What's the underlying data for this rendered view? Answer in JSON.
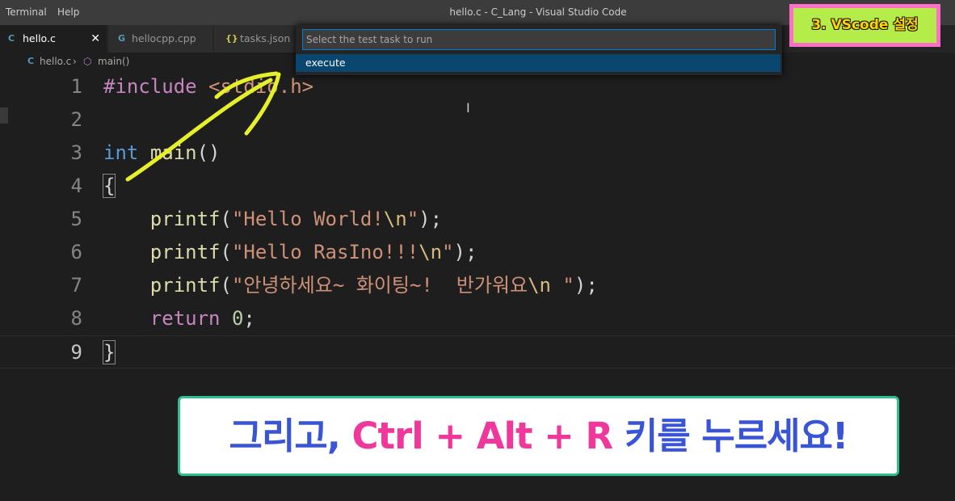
{
  "menu": {
    "terminal": "Terminal",
    "help": "Help"
  },
  "window_title": "hello.c - C_Lang - Visual Studio Code",
  "tabs": [
    {
      "icon": "C",
      "label": "hello.c",
      "close": "✕"
    },
    {
      "icon": "G",
      "label": "hellocpp.cpp"
    },
    {
      "icon": "{}",
      "label": "tasks.json"
    }
  ],
  "breadcrumb": {
    "file": "hello.c",
    "separator": "›",
    "symbol": "main()"
  },
  "quick_pick": {
    "placeholder": "Select the test task to run",
    "items": [
      {
        "label": "execute"
      }
    ]
  },
  "editor": {
    "line_numbers": [
      "1",
      "2",
      "3",
      "4",
      "5",
      "6",
      "7",
      "8",
      "9"
    ],
    "line1": {
      "directive": "#include",
      "header": "<stdio.h>"
    },
    "line3": {
      "type": "int",
      "name": "main",
      "parens": "()"
    },
    "line4": {
      "brace": "{"
    },
    "line5": {
      "indent": "    ",
      "fn": "printf",
      "open": "(",
      "str": "\"Hello World!",
      "esc": "\\n",
      "strend": "\"",
      "close": ");"
    },
    "line6": {
      "indent": "    ",
      "fn": "printf",
      "open": "(",
      "str": "\"Hello RasIno!!!",
      "esc": "\\n",
      "strend": "\"",
      "close": ");"
    },
    "line7": {
      "indent": "    ",
      "fn": "printf",
      "open": "(",
      "str": "\"안녕하세요~ 화이팅~!  반가워요",
      "esc": "\\n",
      "strend": " \"",
      "close": ");"
    },
    "line8": {
      "indent": "    ",
      "kw": "return",
      "sp": " ",
      "num": "0",
      "semi": ";"
    },
    "line9": {
      "brace": "}"
    }
  },
  "overlay_badge": "3. VScode 설정",
  "caption": {
    "part1": "그리고, ",
    "part2": "Ctrl + Alt + R",
    "part3": " 키를 누르세요!"
  },
  "colors": {
    "accent": "#007fd4",
    "selection": "#094771",
    "annotation_arrow": "#e6f028",
    "caption_blue": "#3a54d6",
    "caption_pink": "#f0379b",
    "badge_border": "#ff6ec7",
    "badge_fill": "#b4ec49"
  }
}
